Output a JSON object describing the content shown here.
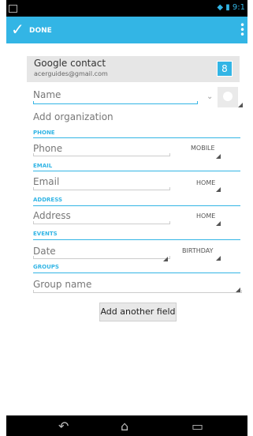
{
  "status": {
    "time": "9:1"
  },
  "actionbar": {
    "done_label": "DONE"
  },
  "account": {
    "name": "Google contact",
    "email": "acerguides@gmail.com",
    "badge": "8"
  },
  "form": {
    "name_placeholder": "Name",
    "organization": "Add organization",
    "phone_section": "PHONE",
    "phone_placeholder": "Phone",
    "phone_type": "MOBILE",
    "email_section": "EMAIL",
    "email_placeholder": "Email",
    "email_type": "HOME",
    "address_section": "ADDRESS",
    "address_placeholder": "Address",
    "address_type": "HOME",
    "events_section": "EVENTS",
    "date_placeholder": "Date",
    "event_type": "BIRTHDAY",
    "groups_section": "GROUPS",
    "group_placeholder": "Group name",
    "add_field_button": "Add another field"
  }
}
